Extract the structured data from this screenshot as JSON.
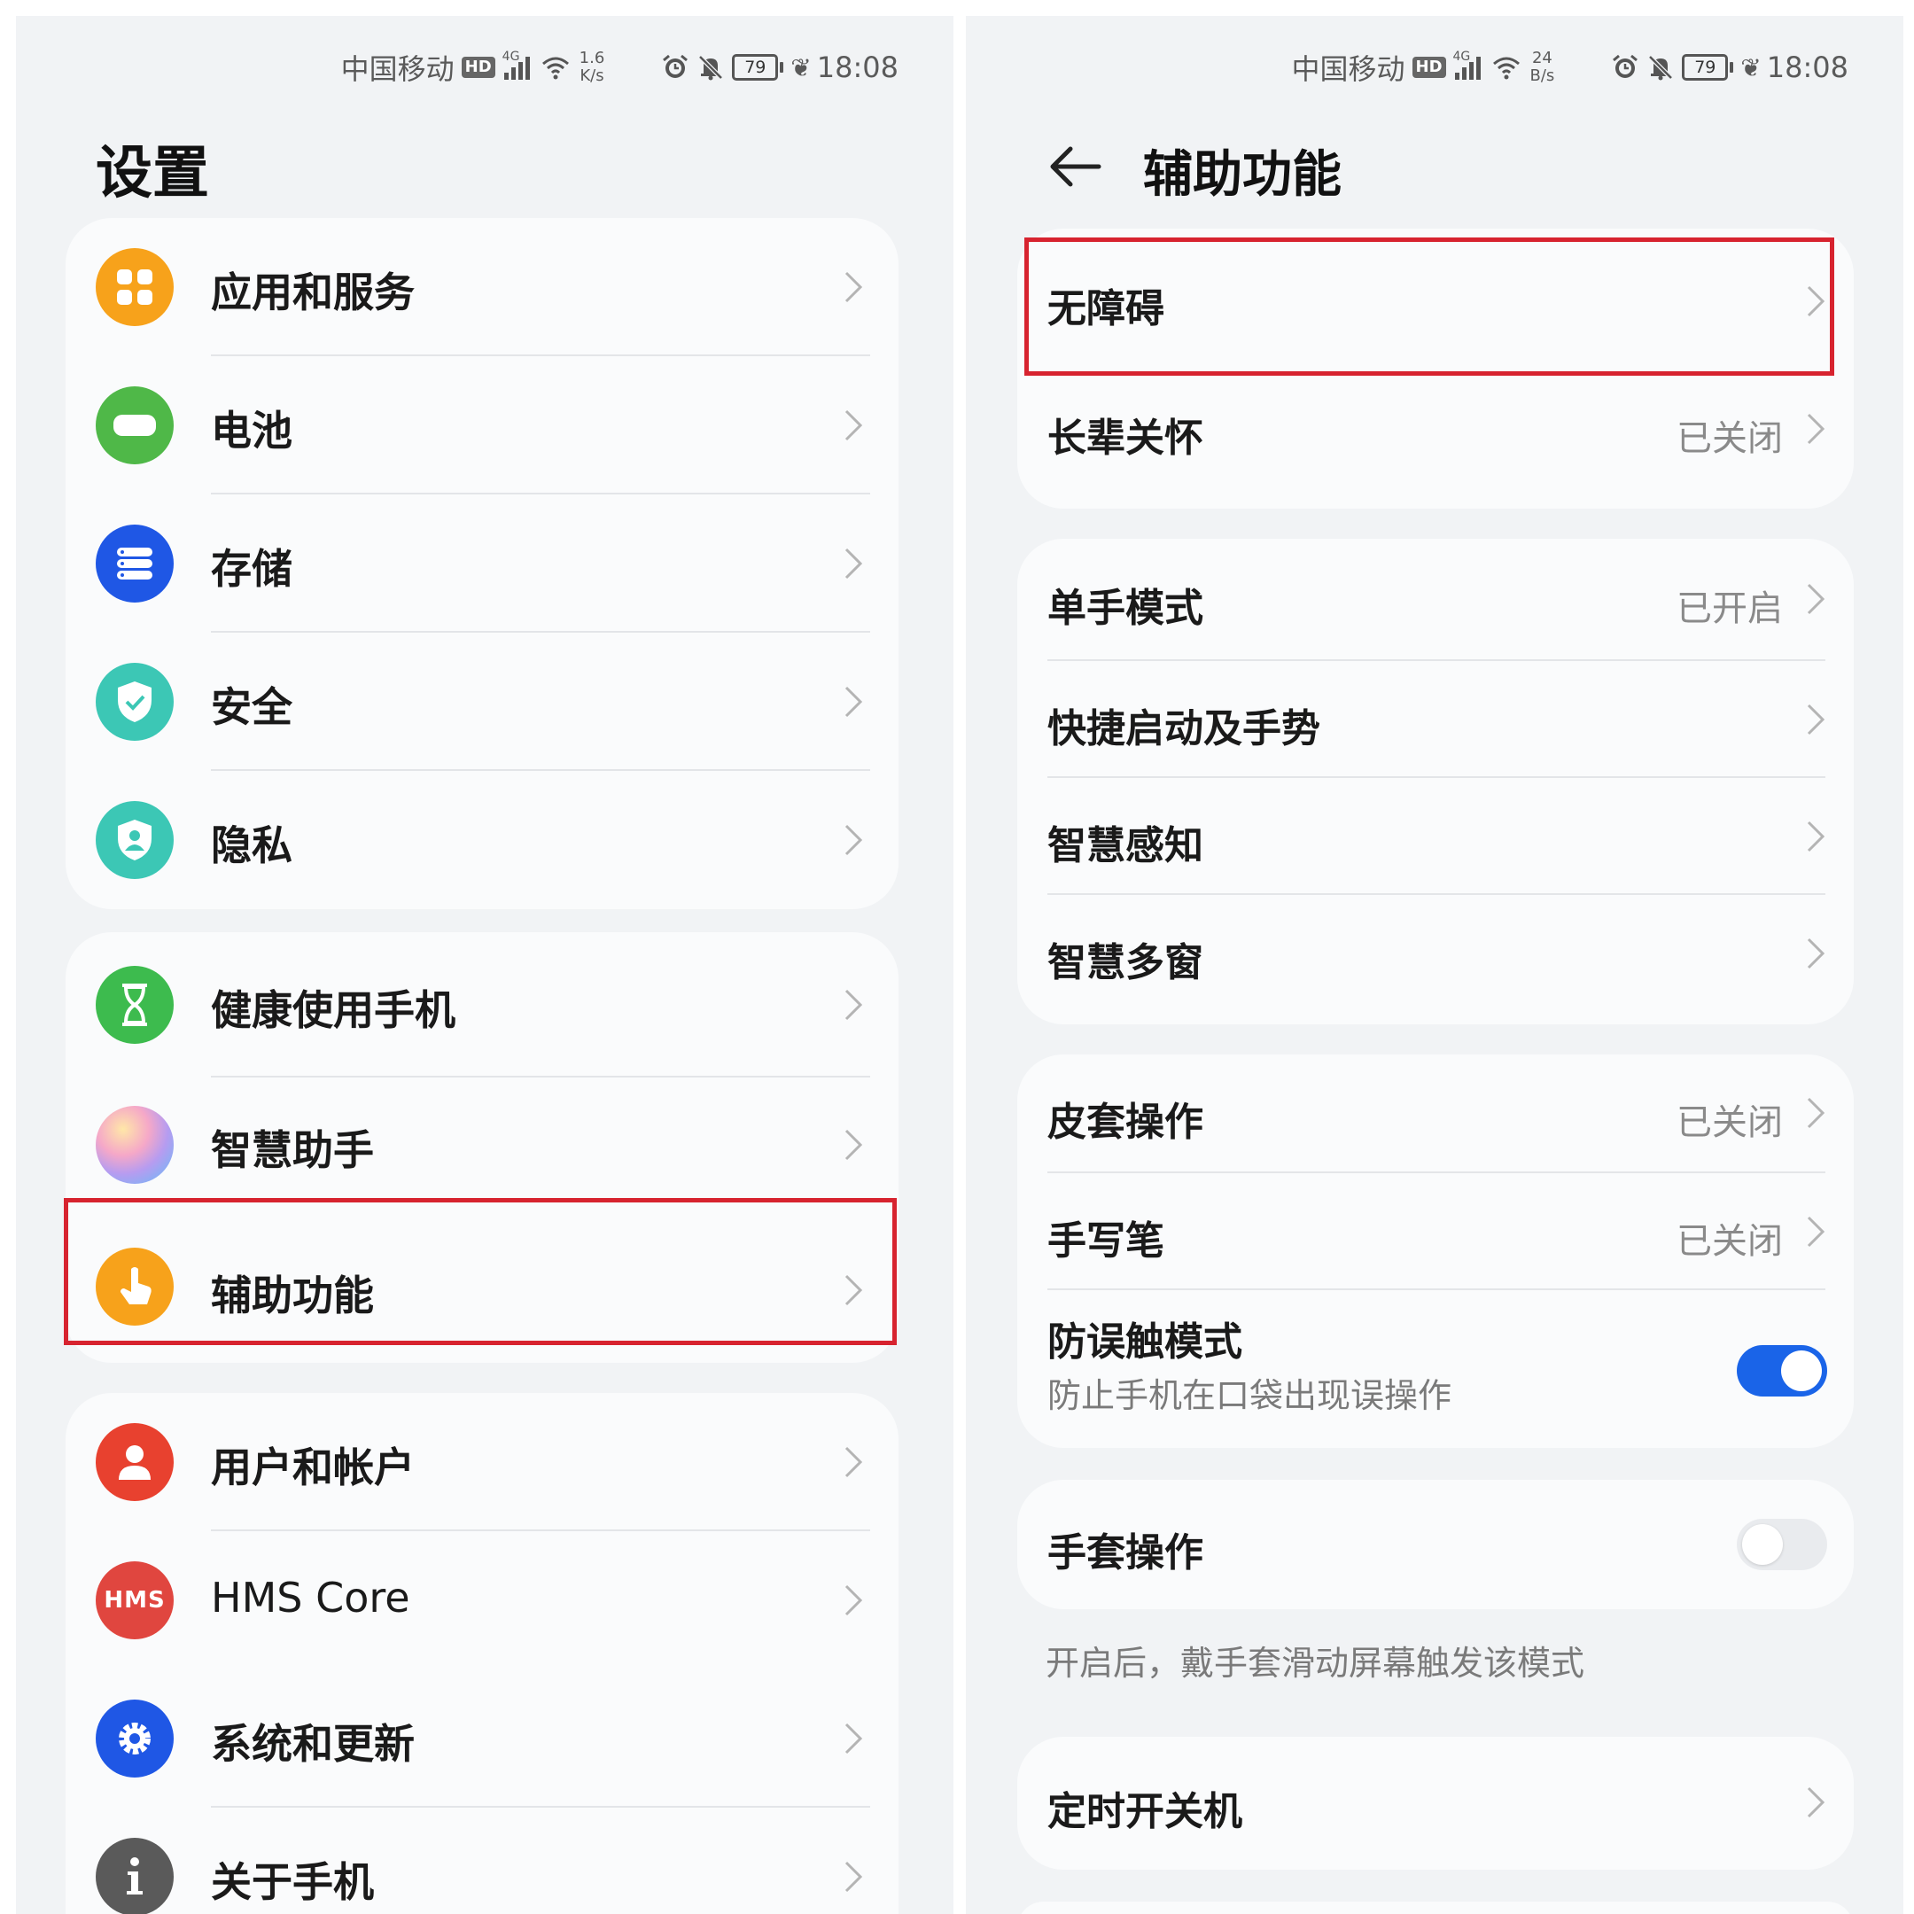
{
  "left_screen": {
    "status_bar": {
      "carrier": "中国移动",
      "hd": "HD",
      "network": "4G",
      "speed_value": "1.6",
      "speed_unit": "K/s",
      "battery": "79",
      "time": "18:08"
    },
    "title": "设置",
    "groups": [
      {
        "items": [
          {
            "label": "应用和服务",
            "icon": "apps-grid-icon",
            "color": "#f7a21b"
          },
          {
            "label": "电池",
            "icon": "battery-icon",
            "color": "#4fb848"
          },
          {
            "label": "存储",
            "icon": "storage-icon",
            "color": "#1f57e5"
          },
          {
            "label": "安全",
            "icon": "shield-check-icon",
            "color": "#3cc7b5"
          },
          {
            "label": "隐私",
            "icon": "privacy-shield-icon",
            "color": "#3cc7b5"
          }
        ]
      },
      {
        "items": [
          {
            "label": "健康使用手机",
            "icon": "hourglass-icon",
            "color": "#3dbb4e"
          },
          {
            "label": "智慧助手",
            "icon": "assistant-orb-icon",
            "color": "#c9a6f3"
          },
          {
            "label": "辅助功能",
            "icon": "hand-tap-icon",
            "color": "#f7a21b",
            "highlighted": true
          }
        ]
      },
      {
        "items": [
          {
            "label": "用户和帐户",
            "icon": "user-icon",
            "color": "#e8412f"
          },
          {
            "label": "HMS Core",
            "icon": "hms-icon",
            "color": "#e0463f",
            "icon_text": "HMS"
          },
          {
            "label": "系统和更新",
            "icon": "gear-icon",
            "color": "#1f57e5"
          },
          {
            "label": "关于手机",
            "icon": "info-icon",
            "color": "#5a5a5a"
          }
        ]
      }
    ]
  },
  "right_screen": {
    "status_bar": {
      "carrier": "中国移动",
      "hd": "HD",
      "network": "4G",
      "speed_value": "24",
      "speed_unit": "B/s",
      "battery": "79",
      "time": "18:08"
    },
    "title": "辅助功能",
    "groups": [
      {
        "items": [
          {
            "label": "无障碍",
            "value": "",
            "highlighted": true
          },
          {
            "label": "长辈关怀",
            "value": "已关闭"
          }
        ]
      },
      {
        "items": [
          {
            "label": "单手模式",
            "value": "已开启"
          },
          {
            "label": "快捷启动及手势",
            "value": ""
          },
          {
            "label": "智慧感知",
            "value": ""
          },
          {
            "label": "智慧多窗",
            "value": ""
          }
        ]
      },
      {
        "items": [
          {
            "label": "皮套操作",
            "value": "已关闭"
          },
          {
            "label": "手写笔",
            "value": "已关闭"
          },
          {
            "label": "防误触模式",
            "description": "防止手机在口袋出现误操作",
            "toggle": true
          }
        ]
      },
      {
        "items": [
          {
            "label": "手套操作",
            "toggle": false
          }
        ]
      },
      {
        "items": [
          {
            "label": "定时开关机",
            "value": ""
          }
        ]
      }
    ],
    "glove_note": "开启后，戴手套滑动屏幕触发该模式"
  },
  "colors": {
    "highlight": "#d7232f",
    "toggle_on": "#1a64e8",
    "panel_bg": "#f1f3f5"
  }
}
